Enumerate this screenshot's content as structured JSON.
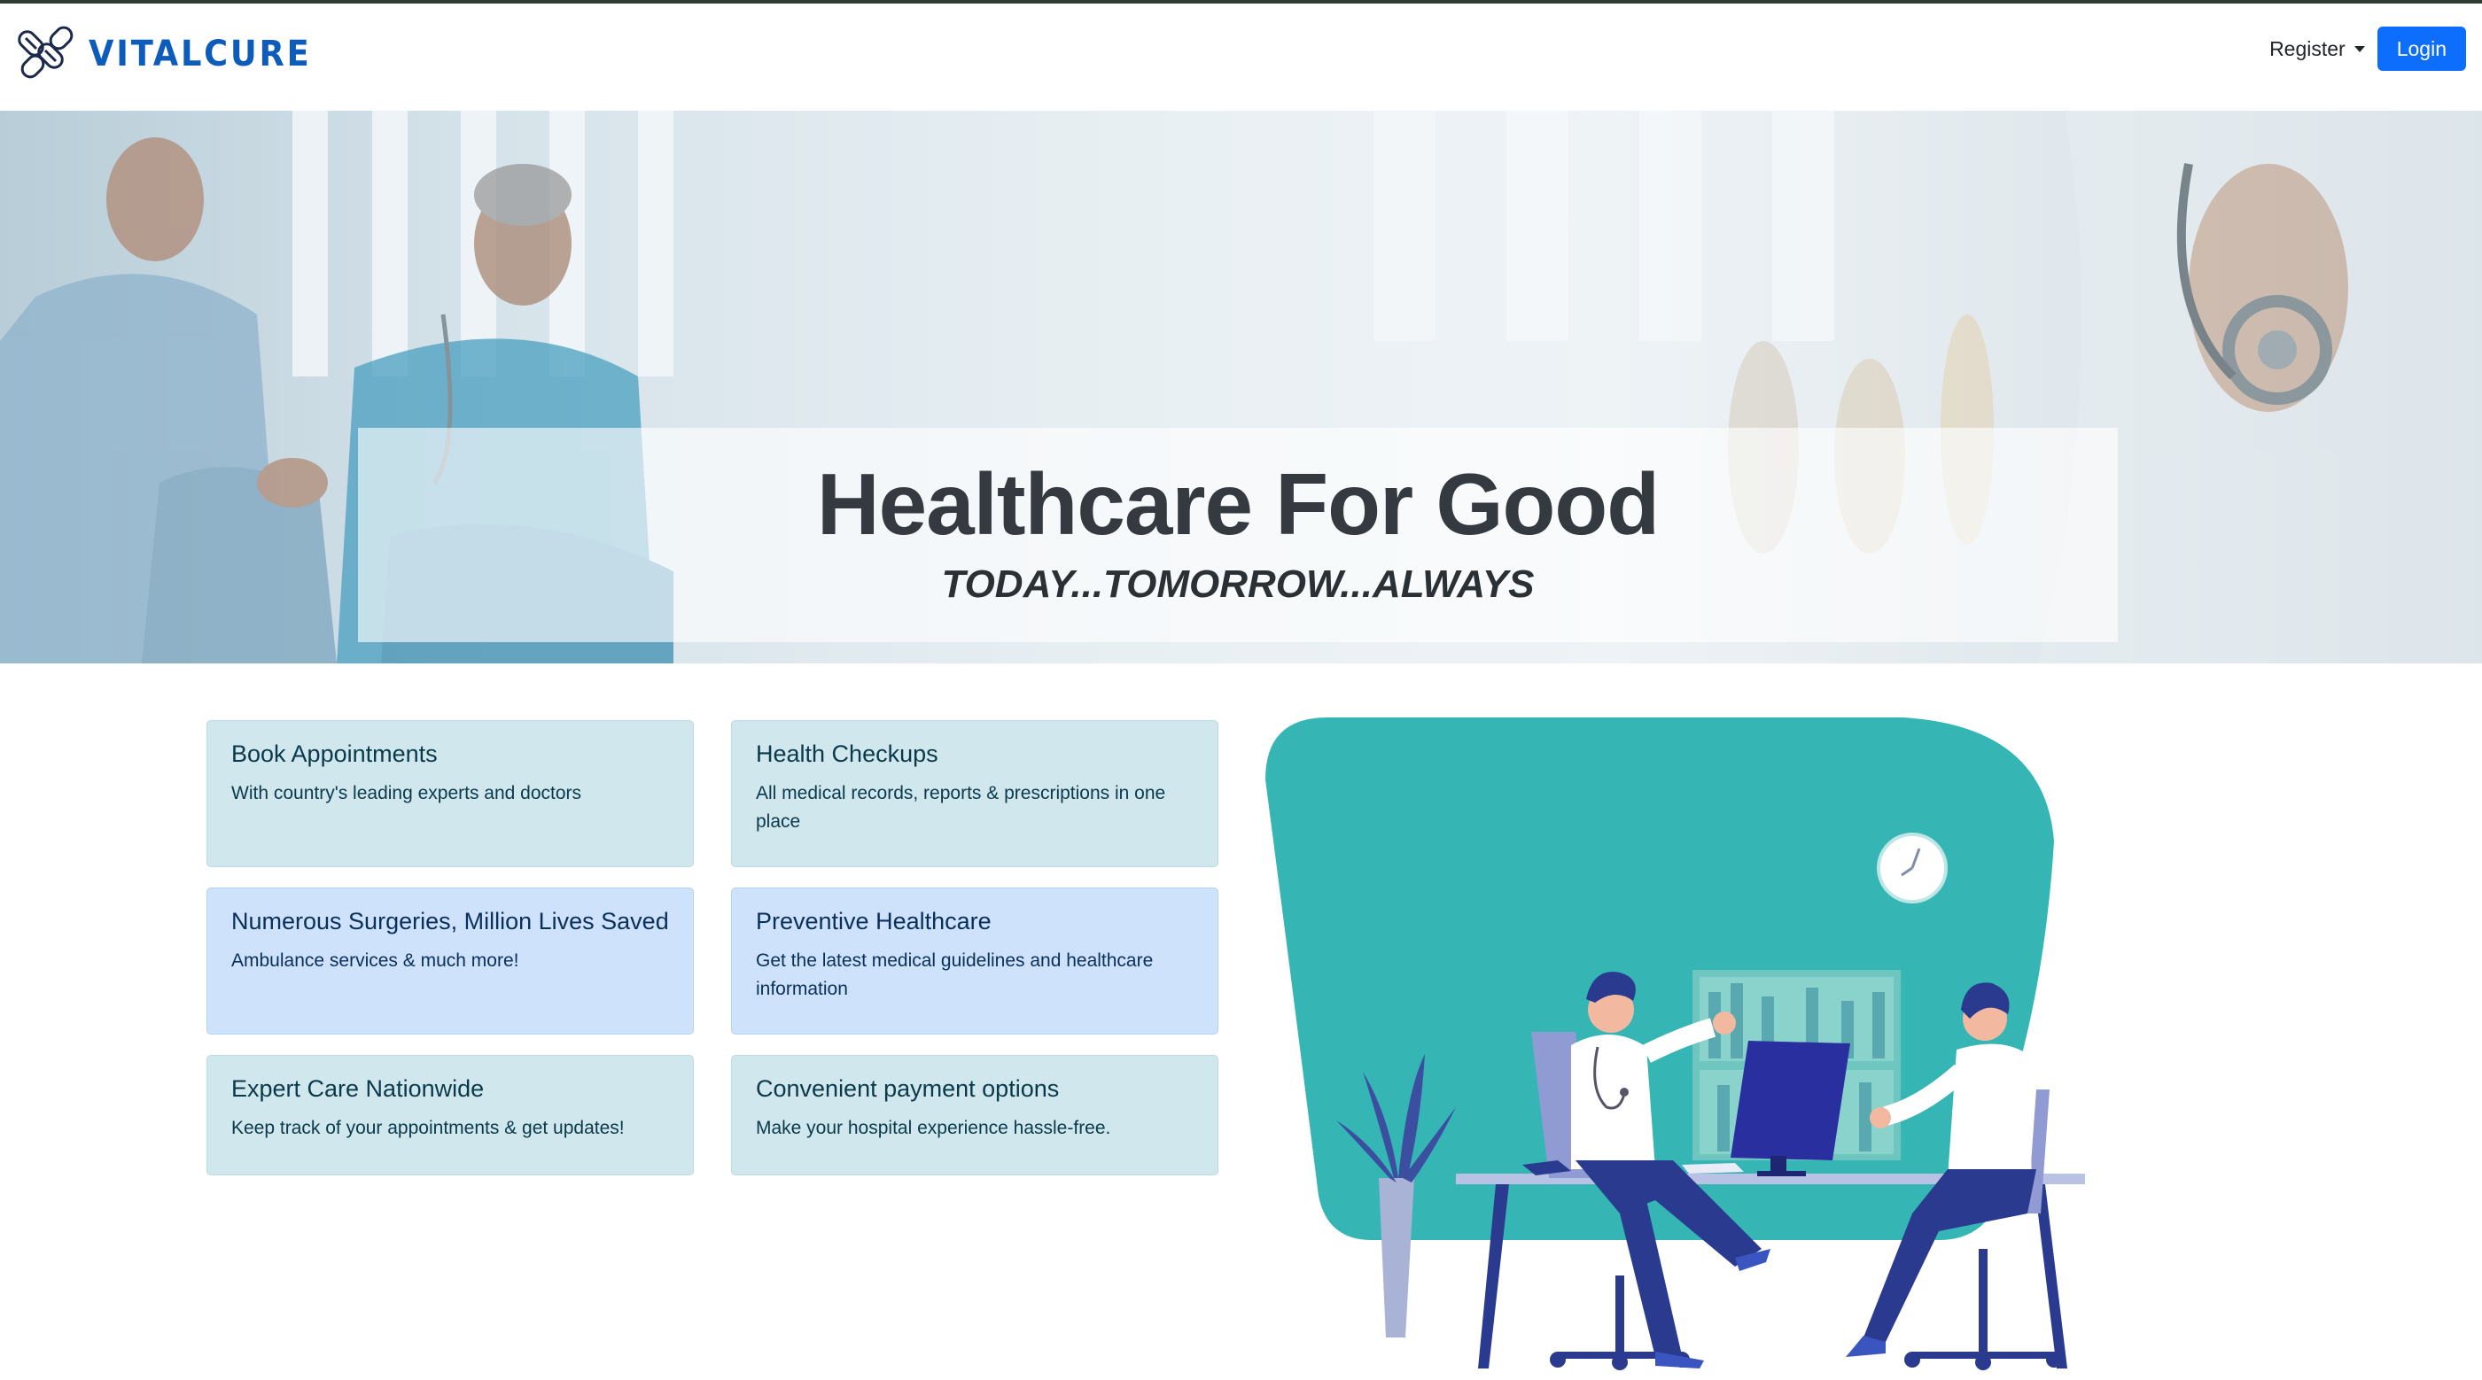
{
  "brand": {
    "name": "VITALCURE",
    "icon": "pills-logo-icon"
  },
  "nav": {
    "register_label": "Register",
    "login_label": "Login"
  },
  "hero": {
    "title": "Healthcare For Good",
    "subtitle": "TODAY...TOMORROW...ALWAYS"
  },
  "cards": [
    {
      "title": "Book Appointments",
      "text": "With country's leading experts and doctors"
    },
    {
      "title": "Health Checkups",
      "text": "All medical records, reports & prescriptions in one place"
    },
    {
      "title": "Numerous Surgeries, Million Lives Saved",
      "text": "Ambulance services & much more!"
    },
    {
      "title": "Preventive Healthcare",
      "text": "Get the latest medical guidelines and healthcare information"
    },
    {
      "title": "Expert Care Nationwide",
      "text": "Keep track of your appointments & get updates!"
    },
    {
      "title": "Convenient payment options",
      "text": "Make your hospital experience hassle-free."
    }
  ],
  "colors": {
    "brand": "#0d5cbb",
    "login": "#0d6efd",
    "teal": "#35b5b4",
    "navy": "#2a3b8f"
  }
}
